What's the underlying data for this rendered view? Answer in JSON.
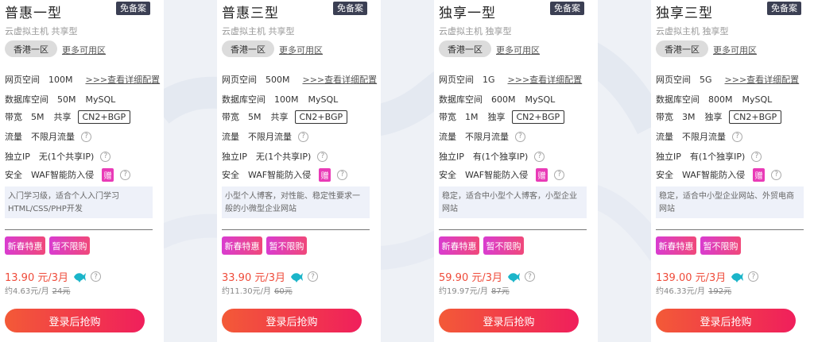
{
  "colors": {
    "accent": "#ef4b3a",
    "badge": "#3b3f53",
    "tag": "#e93bb7"
  },
  "labels": {
    "badge": "免备案",
    "region": "香港一区",
    "more": "更多可用区",
    "web_space": "网页空间",
    "detail_link": ">>>查看详细配置",
    "database": "数据库空间",
    "database_type": "MySQL",
    "bandwidth": "带宽",
    "bandwidth_tag": "CN2+BGP",
    "traffic": "流量",
    "traffic_val": "不限月流量",
    "ip": "独立IP",
    "security": "安全",
    "security_val": "WAF智能防入侵",
    "gift": "赠",
    "promo_1": "新春特惠",
    "promo_2": "暂不限购",
    "buy": "登录后抢购",
    "help": "?"
  },
  "plans": [
    {
      "title": "普惠一型",
      "subtitle": "云虚拟主机 共享型",
      "web_space": "100M",
      "database": "50M",
      "bandwidth": "5M",
      "bandwidth_type": "共享",
      "ip": "无(1个共享IP)",
      "desc": "入门学习级，适合个人入门学习HTML/CSS/PHP开发",
      "price": "13.90 元/3月",
      "monthly": "约4.63元/月",
      "original": "24元"
    },
    {
      "title": "普惠三型",
      "subtitle": "云虚拟主机 共享型",
      "web_space": "500M",
      "database": "100M",
      "bandwidth": "5M",
      "bandwidth_type": "共享",
      "ip": "无(1个共享IP)",
      "desc": "小型个人博客，对性能、稳定性要求一般的小微型企业网站",
      "price": "33.90 元/3月",
      "monthly": "约11.30元/月",
      "original": "60元"
    },
    {
      "title": "独享一型",
      "subtitle": "云虚拟主机 独享型",
      "web_space": "1G",
      "database": "600M",
      "bandwidth": "1M",
      "bandwidth_type": "独享",
      "ip": "有(1个独享IP)",
      "desc": "稳定，适合中小型个人博客，小型企业网站",
      "price": "59.90 元/3月",
      "monthly": "约19.97元/月",
      "original": "87元"
    },
    {
      "title": "独享三型",
      "subtitle": "云虚拟主机 独享型",
      "web_space": "5G",
      "database": "800M",
      "bandwidth": "3M",
      "bandwidth_type": "独享",
      "ip": "有(1个独享IP)",
      "desc": "稳定，适合中小型企业网站、外贸电商网站",
      "price": "139.00 元/3月",
      "monthly": "约46.33元/月",
      "original": "192元"
    }
  ]
}
